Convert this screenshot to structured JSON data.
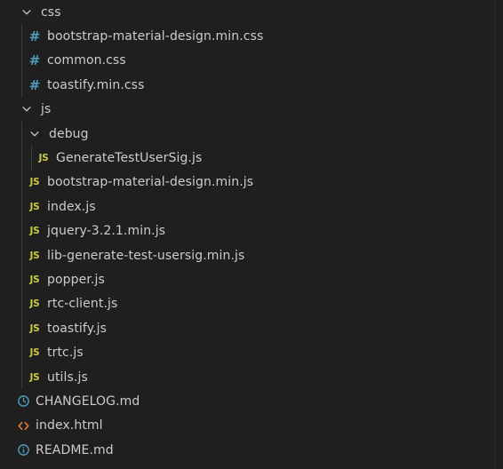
{
  "explorer": {
    "items": [
      {
        "label": "css",
        "kind": "folder",
        "depth": 1,
        "icon": "chevron-down-icon",
        "name": "folder-css"
      },
      {
        "label": "bootstrap-material-design.min.css",
        "kind": "css",
        "depth": 2,
        "icon": "css-file-icon",
        "glyph": "#",
        "name": "file-bootstrap-material-design-min-css"
      },
      {
        "label": "common.css",
        "kind": "css",
        "depth": 2,
        "icon": "css-file-icon",
        "glyph": "#",
        "name": "file-common-css"
      },
      {
        "label": "toastify.min.css",
        "kind": "css",
        "depth": 2,
        "icon": "css-file-icon",
        "glyph": "#",
        "name": "file-toastify-min-css"
      },
      {
        "label": "js",
        "kind": "folder",
        "depth": 1,
        "icon": "chevron-down-icon",
        "name": "folder-js"
      },
      {
        "label": "debug",
        "kind": "folder",
        "depth": 2,
        "icon": "chevron-down-icon",
        "name": "folder-debug"
      },
      {
        "label": "GenerateTestUserSig.js",
        "kind": "js",
        "depth": 3,
        "icon": "js-file-icon",
        "glyph": "JS",
        "name": "file-generatetestusersig-js"
      },
      {
        "label": "bootstrap-material-design.min.js",
        "kind": "js",
        "depth": 2,
        "icon": "js-file-icon",
        "glyph": "JS",
        "name": "file-bootstrap-material-design-min-js"
      },
      {
        "label": "index.js",
        "kind": "js",
        "depth": 2,
        "icon": "js-file-icon",
        "glyph": "JS",
        "name": "file-index-js"
      },
      {
        "label": "jquery-3.2.1.min.js",
        "kind": "js",
        "depth": 2,
        "icon": "js-file-icon",
        "glyph": "JS",
        "name": "file-jquery-min-js"
      },
      {
        "label": "lib-generate-test-usersig.min.js",
        "kind": "js",
        "depth": 2,
        "icon": "js-file-icon",
        "glyph": "JS",
        "name": "file-lib-generate-test-usersig-min-js"
      },
      {
        "label": "popper.js",
        "kind": "js",
        "depth": 2,
        "icon": "js-file-icon",
        "glyph": "JS",
        "name": "file-popper-js"
      },
      {
        "label": "rtc-client.js",
        "kind": "js",
        "depth": 2,
        "icon": "js-file-icon",
        "glyph": "JS",
        "name": "file-rtc-client-js"
      },
      {
        "label": "toastify.js",
        "kind": "js",
        "depth": 2,
        "icon": "js-file-icon",
        "glyph": "JS",
        "name": "file-toastify-js"
      },
      {
        "label": "trtc.js",
        "kind": "js",
        "depth": 2,
        "icon": "js-file-icon",
        "glyph": "JS",
        "name": "file-trtc-js"
      },
      {
        "label": "utils.js",
        "kind": "js",
        "depth": 2,
        "icon": "js-file-icon",
        "glyph": "JS",
        "name": "file-utils-js"
      },
      {
        "label": "CHANGELOG.md",
        "kind": "changelog",
        "depth": 0,
        "icon": "clock-icon",
        "name": "file-changelog-md"
      },
      {
        "label": "index.html",
        "kind": "html",
        "depth": 0,
        "icon": "html-code-icon",
        "name": "file-index-html"
      },
      {
        "label": "README.md",
        "kind": "readme",
        "depth": 0,
        "icon": "info-icon",
        "name": "file-readme-md"
      }
    ]
  },
  "colors": {
    "background": "#1f1f1f",
    "text": "#cccccc",
    "css_icon": "#519aba",
    "js_icon": "#cbcb41",
    "md_icon": "#519aba",
    "html_icon": "#e37933",
    "chevron": "#c5c5c5",
    "indent_guide": "#3c3c3c"
  }
}
